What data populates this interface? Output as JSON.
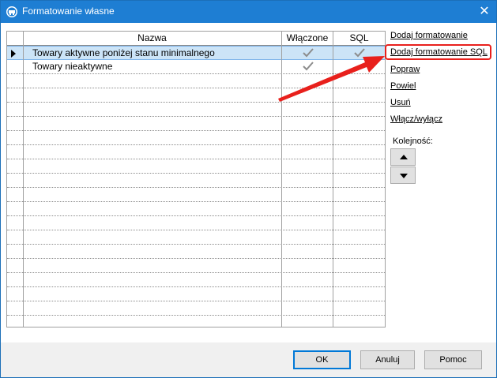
{
  "window": {
    "title": "Formatowanie własne",
    "close_glyph": "✕"
  },
  "grid": {
    "columns": [
      "Nazwa",
      "Włączone",
      "SQL"
    ],
    "rows": [
      {
        "name": "Towary aktywne poniżej stanu minimalnego",
        "enabled": true,
        "sql": true,
        "selected": true
      },
      {
        "name": "Towary nieaktywne",
        "enabled": true,
        "sql": false,
        "selected": false
      }
    ],
    "empty_row_count": 17
  },
  "sidebar": {
    "add_formatting": "Dodaj formatowanie",
    "add_sql_formatting": "Dodaj formatowanie SQL",
    "edit": "Popraw",
    "duplicate": "Powiel",
    "delete": "Usuń",
    "toggle": "Włącz/wyłącz",
    "order_label": "Kolejność:"
  },
  "footer": {
    "ok": "OK",
    "cancel": "Anuluj",
    "help": "Pomoc"
  },
  "colors": {
    "titlebar": "#1e7ed3",
    "selection": "#cce4f7",
    "annotation": "#e8201c",
    "check": "#8c8c8c"
  }
}
